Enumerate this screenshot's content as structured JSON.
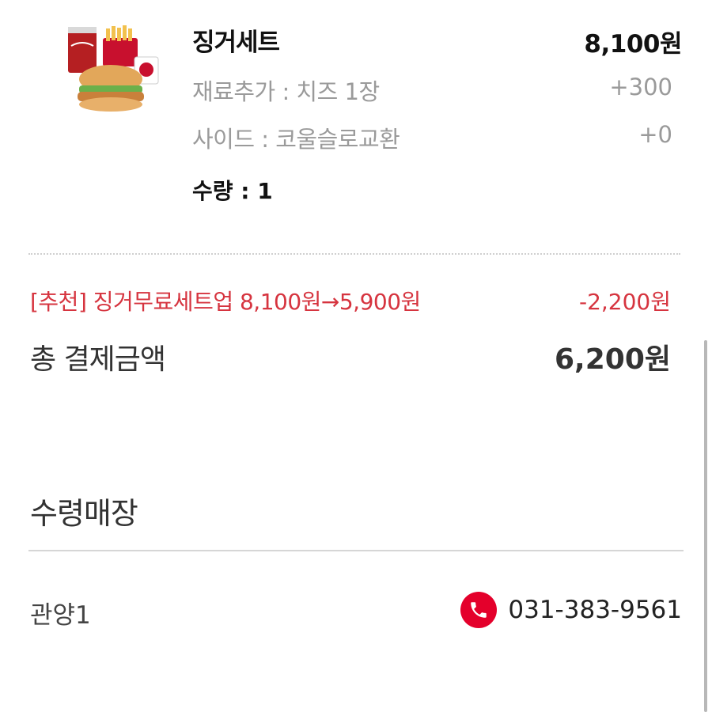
{
  "item": {
    "name": "징거세트",
    "price": "8,100원",
    "options": [
      {
        "label": "재료추가 : 치즈 1장",
        "price": "+300"
      },
      {
        "label": "사이드 : 코울슬로교환",
        "price": "+0"
      }
    ],
    "quantity": "수량 : 1",
    "image_icon": "burger-set-photo"
  },
  "promo": {
    "text": "[추천] 징거무료세트업 8,100원→5,900원",
    "amount": "-2,200원"
  },
  "total": {
    "label": "총 결제금액",
    "amount": "6,200원"
  },
  "pickup": {
    "title": "수령매장",
    "store_name": "관양1",
    "phone": "031-383-9561",
    "phone_icon": "phone-icon"
  },
  "colors": {
    "promo": "#d6343f",
    "phone_badge": "#e4002b"
  }
}
